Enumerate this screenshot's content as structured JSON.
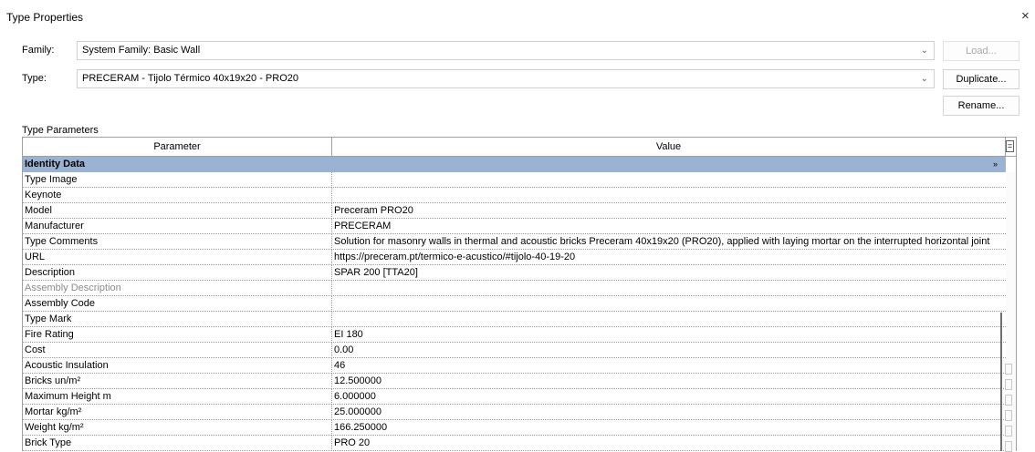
{
  "window": {
    "title": "Type Properties",
    "close_glyph": "×"
  },
  "family": {
    "label": "Family:",
    "value": "System Family: Basic Wall"
  },
  "type": {
    "label": "Type:",
    "value": "PRECERAM - Tijolo Térmico 40x19x20 - PRO20"
  },
  "buttons": {
    "load": "Load...",
    "duplicate": "Duplicate...",
    "rename": "Rename..."
  },
  "type_parameters": {
    "title": "Type Parameters",
    "columns": {
      "parameter": "Parameter",
      "value": "Value"
    },
    "header_button": "=",
    "group": {
      "name": "Identity Data",
      "caret": "»"
    },
    "rows": [
      {
        "param": "Type Image",
        "value": ""
      },
      {
        "param": "Keynote",
        "value": ""
      },
      {
        "param": "Model",
        "value": "Preceram PRO20"
      },
      {
        "param": "Manufacturer",
        "value": "PRECERAM"
      },
      {
        "param": "Type Comments",
        "value": "Solution for masonry walls in thermal and acoustic bricks Preceram 40x19x20 (PRO20), applied with laying mortar on the interrupted horizontal joint"
      },
      {
        "param": "URL",
        "value": "https://preceram.pt/termico-e-acustico/#tijolo-40-19-20"
      },
      {
        "param": "Description",
        "value": "SPAR 200 [TTA20]"
      },
      {
        "param": "Assembly Description",
        "value": "",
        "dim": true
      },
      {
        "param": "Assembly Code",
        "value": ""
      },
      {
        "param": "Type Mark",
        "value": ""
      },
      {
        "param": "Fire Rating",
        "value": "EI 180"
      },
      {
        "param": "Cost",
        "value": "0.00"
      },
      {
        "param": "Acoustic Insulation",
        "value": "46"
      },
      {
        "param": "Bricks un/m²",
        "value": "12.500000"
      },
      {
        "param": "Maximum Height m",
        "value": "6.000000"
      },
      {
        "param": "Mortar kg/m²",
        "value": "25.000000"
      },
      {
        "param": "Weight kg/m²",
        "value": "166.250000"
      },
      {
        "param": "Brick Type",
        "value": "PRO 20"
      }
    ]
  },
  "colors": {
    "group_header": "#9ab3d3",
    "grid_border": "#a0a0a0",
    "disabled_text": "#a8a8a8"
  }
}
